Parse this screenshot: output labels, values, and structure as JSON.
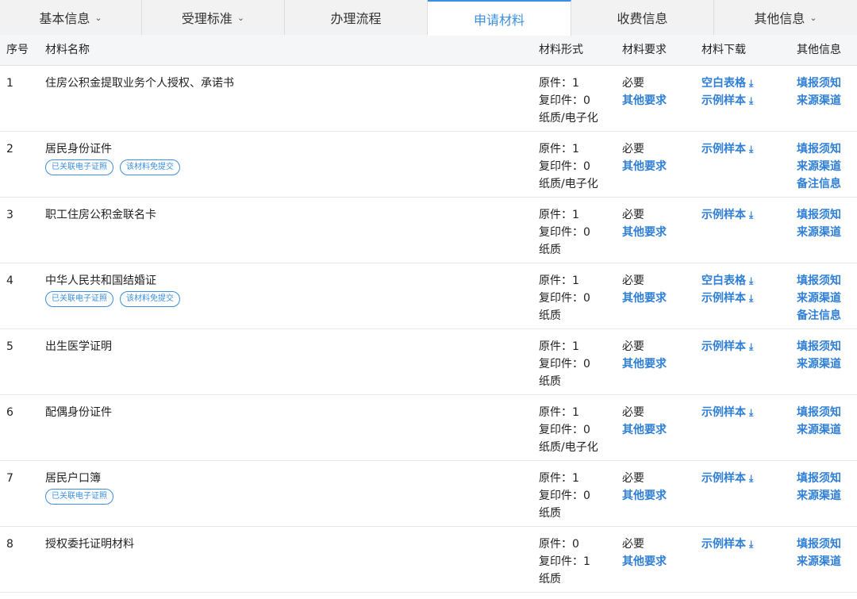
{
  "tabs": [
    {
      "label": "基本信息",
      "chevron": true,
      "active": false,
      "width": 179
    },
    {
      "label": "受理标准",
      "chevron": true,
      "active": false,
      "width": 180
    },
    {
      "label": "办理流程",
      "chevron": false,
      "active": false,
      "width": 180
    },
    {
      "label": "申请材料",
      "chevron": false,
      "active": true,
      "width": 181
    },
    {
      "label": "收费信息",
      "chevron": false,
      "active": false,
      "width": 180
    },
    {
      "label": "其他信息",
      "chevron": true,
      "active": false,
      "width": 180
    }
  ],
  "table": {
    "headers": {
      "no": "序号",
      "name": "材料名称",
      "form": "材料形式",
      "req": "材料要求",
      "dl": "材料下载",
      "other": "其他信息"
    },
    "rows": [
      {
        "no": "1",
        "name": "住房公积金提取业务个人授权、承诺书",
        "badges": [],
        "form": [
          "原件：1",
          "复印件：0",
          "纸质/电子化"
        ],
        "req_text": "必要",
        "req_link": "其他要求",
        "dl": [
          "空白表格",
          "示例样本"
        ],
        "other": [
          "填报须知",
          "来源渠道"
        ]
      },
      {
        "no": "2",
        "name": "居民身份证件",
        "badges": [
          "已关联电子证照",
          "该材料免提交"
        ],
        "form": [
          "原件：1",
          "复印件：0",
          "纸质/电子化"
        ],
        "req_text": "必要",
        "req_link": "其他要求",
        "dl": [
          "示例样本"
        ],
        "other": [
          "填报须知",
          "来源渠道",
          "备注信息"
        ]
      },
      {
        "no": "3",
        "name": "职工住房公积金联名卡",
        "badges": [],
        "form": [
          "原件：1",
          "复印件：0",
          "纸质"
        ],
        "req_text": "必要",
        "req_link": "其他要求",
        "dl": [
          "示例样本"
        ],
        "other": [
          "填报须知",
          "来源渠道"
        ]
      },
      {
        "no": "4",
        "name": "中华人民共和国结婚证",
        "badges": [
          "已关联电子证照",
          "该材料免提交"
        ],
        "form": [
          "原件：1",
          "复印件：0",
          "纸质"
        ],
        "req_text": "必要",
        "req_link": "其他要求",
        "dl": [
          "空白表格",
          "示例样本"
        ],
        "other": [
          "填报须知",
          "来源渠道",
          "备注信息"
        ]
      },
      {
        "no": "5",
        "name": "出生医学证明",
        "badges": [],
        "form": [
          "原件：1",
          "复印件：0",
          "纸质"
        ],
        "req_text": "必要",
        "req_link": "其他要求",
        "dl": [
          "示例样本"
        ],
        "other": [
          "填报须知",
          "来源渠道"
        ]
      },
      {
        "no": "6",
        "name": "配偶身份证件",
        "badges": [],
        "form": [
          "原件：1",
          "复印件：0",
          "纸质/电子化"
        ],
        "req_text": "必要",
        "req_link": "其他要求",
        "dl": [
          "示例样本"
        ],
        "other": [
          "填报须知",
          "来源渠道"
        ]
      },
      {
        "no": "7",
        "name": "居民户口簿",
        "badges": [
          "已关联电子证照"
        ],
        "form": [
          "原件：1",
          "复印件：0",
          "纸质"
        ],
        "req_text": "必要",
        "req_link": "其他要求",
        "dl": [
          "示例样本"
        ],
        "other": [
          "填报须知",
          "来源渠道"
        ]
      },
      {
        "no": "8",
        "name": "授权委托证明材料",
        "badges": [],
        "form": [
          "原件：0",
          "复印件：1",
          "纸质"
        ],
        "req_text": "必要",
        "req_link": "其他要求",
        "dl": [
          "示例样本"
        ],
        "other": [
          "填报须知",
          "来源渠道"
        ]
      }
    ]
  },
  "icons": {
    "chevron": "chevron-down-icon",
    "download": "download-icon"
  },
  "colors": {
    "accent": "#3c8fe0",
    "link": "#2f7fd6"
  }
}
